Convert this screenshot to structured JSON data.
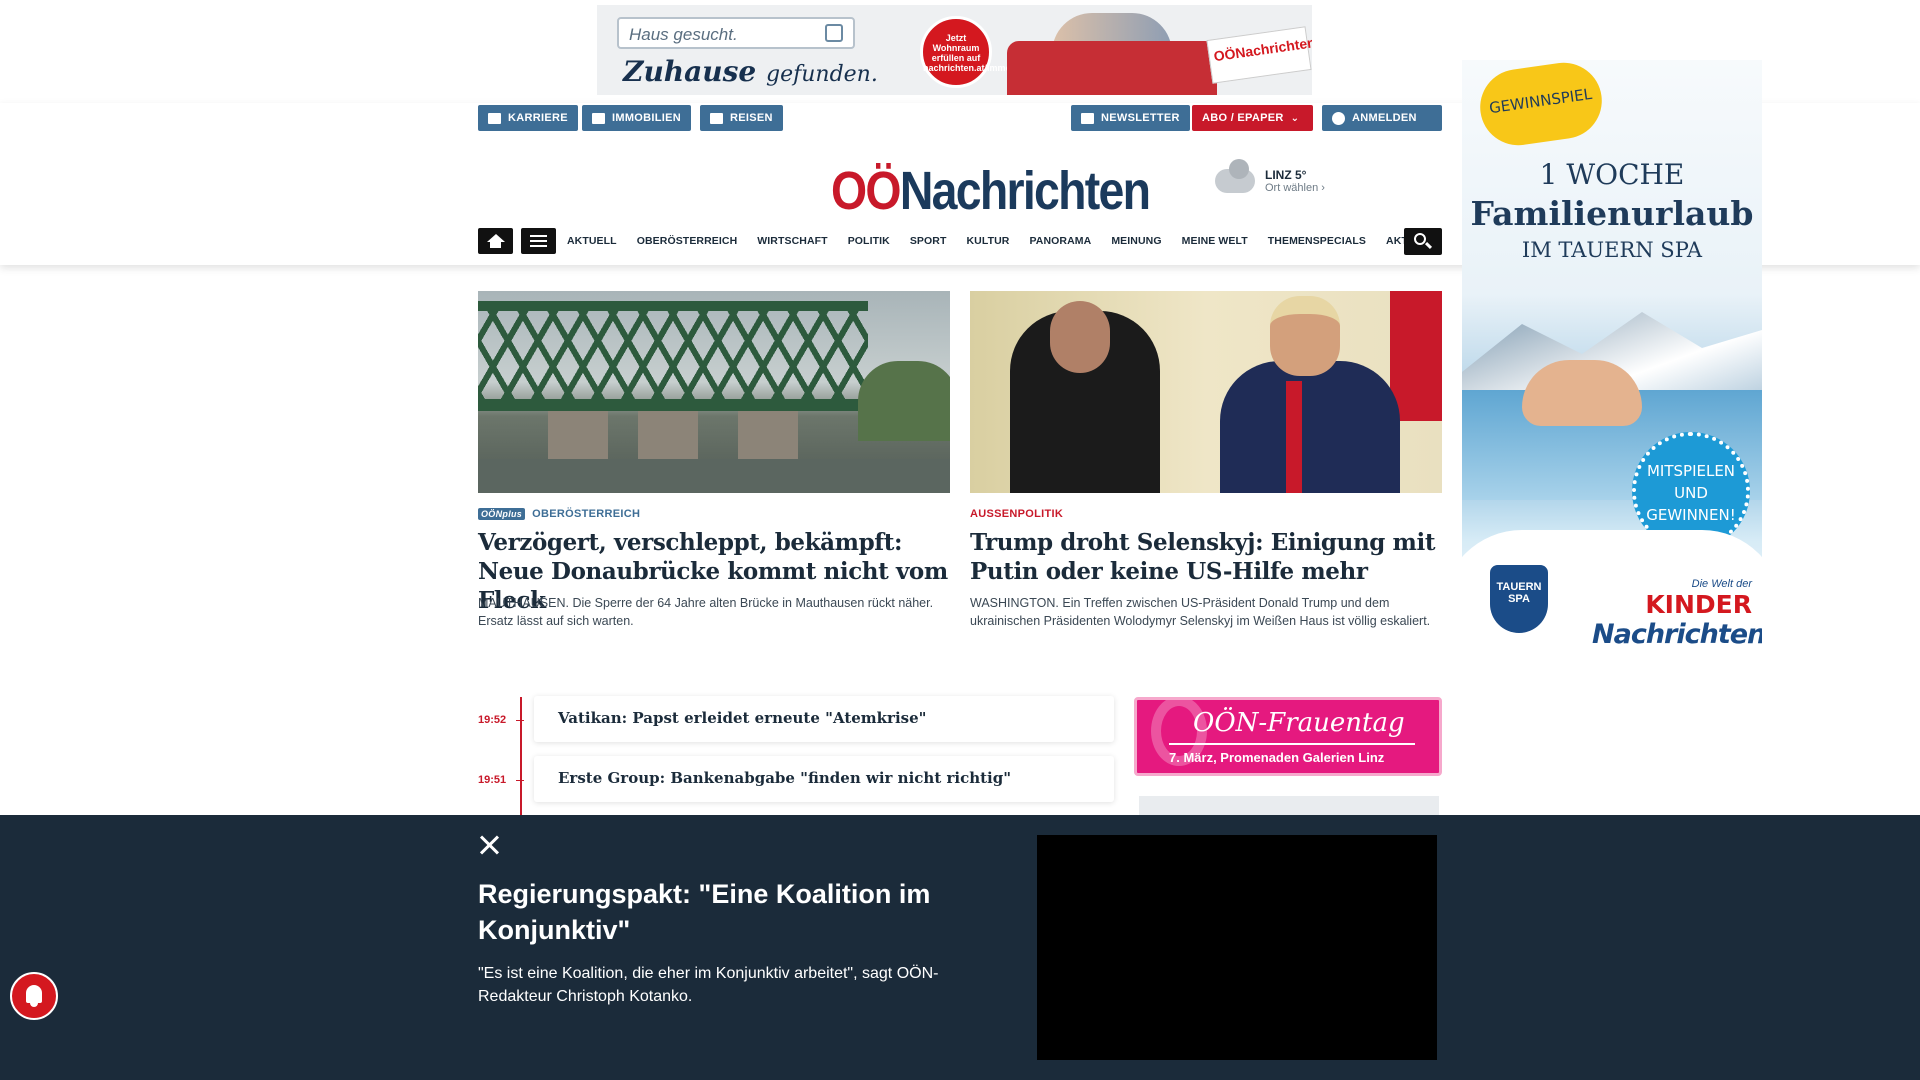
{
  "top_ad": {
    "search_text": "Haus gesucht.",
    "slogan_main": "Zuhause",
    "slogan_small": "gefunden.",
    "badge": "Jetzt Wohnraum erfüllen auf nachrichten.at/immobilien",
    "paper": "OÖNachrichten"
  },
  "service_links": [
    {
      "label": "KARRIERE"
    },
    {
      "label": "IMMOBILIEN"
    },
    {
      "label": "REISEN"
    }
  ],
  "account": {
    "newsletter": "NEWSLETTER",
    "abo": "ABO / EPAPER",
    "login": "ANMELDEN"
  },
  "logo": {
    "part1": "OÖ",
    "part2": "Nachrichten"
  },
  "weather": {
    "city": "LINZ 5°",
    "choose": "Ort wählen"
  },
  "nav": {
    "items": [
      "AKTUELL",
      "OBERÖSTERREICH",
      "WIRTSCHAFT",
      "POLITIK",
      "SPORT",
      "KULTUR",
      "PANORAMA",
      "MEINUNG",
      "MEINE WELT",
      "THEMENSPECIALS",
      "AKTIONEN"
    ]
  },
  "side_ad": {
    "game": "GEWINNSPIEL",
    "line1": "1 WOCHE",
    "line2": "Familienurlaub",
    "line3": "IM TAUERN SPA",
    "play": "MITSPIELEN UND GEWINNEN!",
    "brand1": "TAUERN SPA",
    "brand2_top": "Die Welt der",
    "brand2_mid": "KINDER",
    "brand2_bottom": "Nachrichten"
  },
  "articles": [
    {
      "plus": "OÖNplus",
      "category": "OBERÖSTERREICH",
      "category_color": "#3e6e96",
      "title": "Verzögert, verschleppt, bekämpft: Neue Donaubrücke kommt nicht vom Fleck",
      "lead": "MAUTHAUSEN. Die Sperre der 64 Jahre alten Brücke in Mauthausen rückt näher. Ersatz lässt auf sich warten."
    },
    {
      "category": "AUSSENPOLITIK",
      "category_color": "#c8192a",
      "title": "Trump droht Selenskyj: Einigung mit Putin oder keine US-Hilfe mehr",
      "lead": "WASHINGTON. Ein Treffen zwischen US-Präsident Donald Trump und dem ukrainischen Präsidenten Wolodymyr Selenskyj im Weißen Haus ist völlig eskaliert."
    }
  ],
  "ticker": [
    {
      "time": "19:52",
      "text": "Vatikan: Papst erleidet erneute \"Atemkrise\""
    },
    {
      "time": "19:51",
      "text": "Erste Group: Bankenabgabe \"finden wir nicht richtig\""
    }
  ],
  "frauentag": {
    "title": "OÖN-Frauentag",
    "subtitle": "7. März, Promenaden Galerien Linz"
  },
  "video": {
    "title": "Regierungspakt: \"Eine Koalition im Konjunktiv\"",
    "lead": "\"Es ist eine Koalition, die eher im Konjunktiv arbeitet\", sagt OÖN-Redakteur Christoph Kotanko."
  },
  "colors": {
    "brand_red": "#c8192a",
    "brand_blue": "#3e6e96",
    "overlay_bg": "#1b2b3a"
  }
}
